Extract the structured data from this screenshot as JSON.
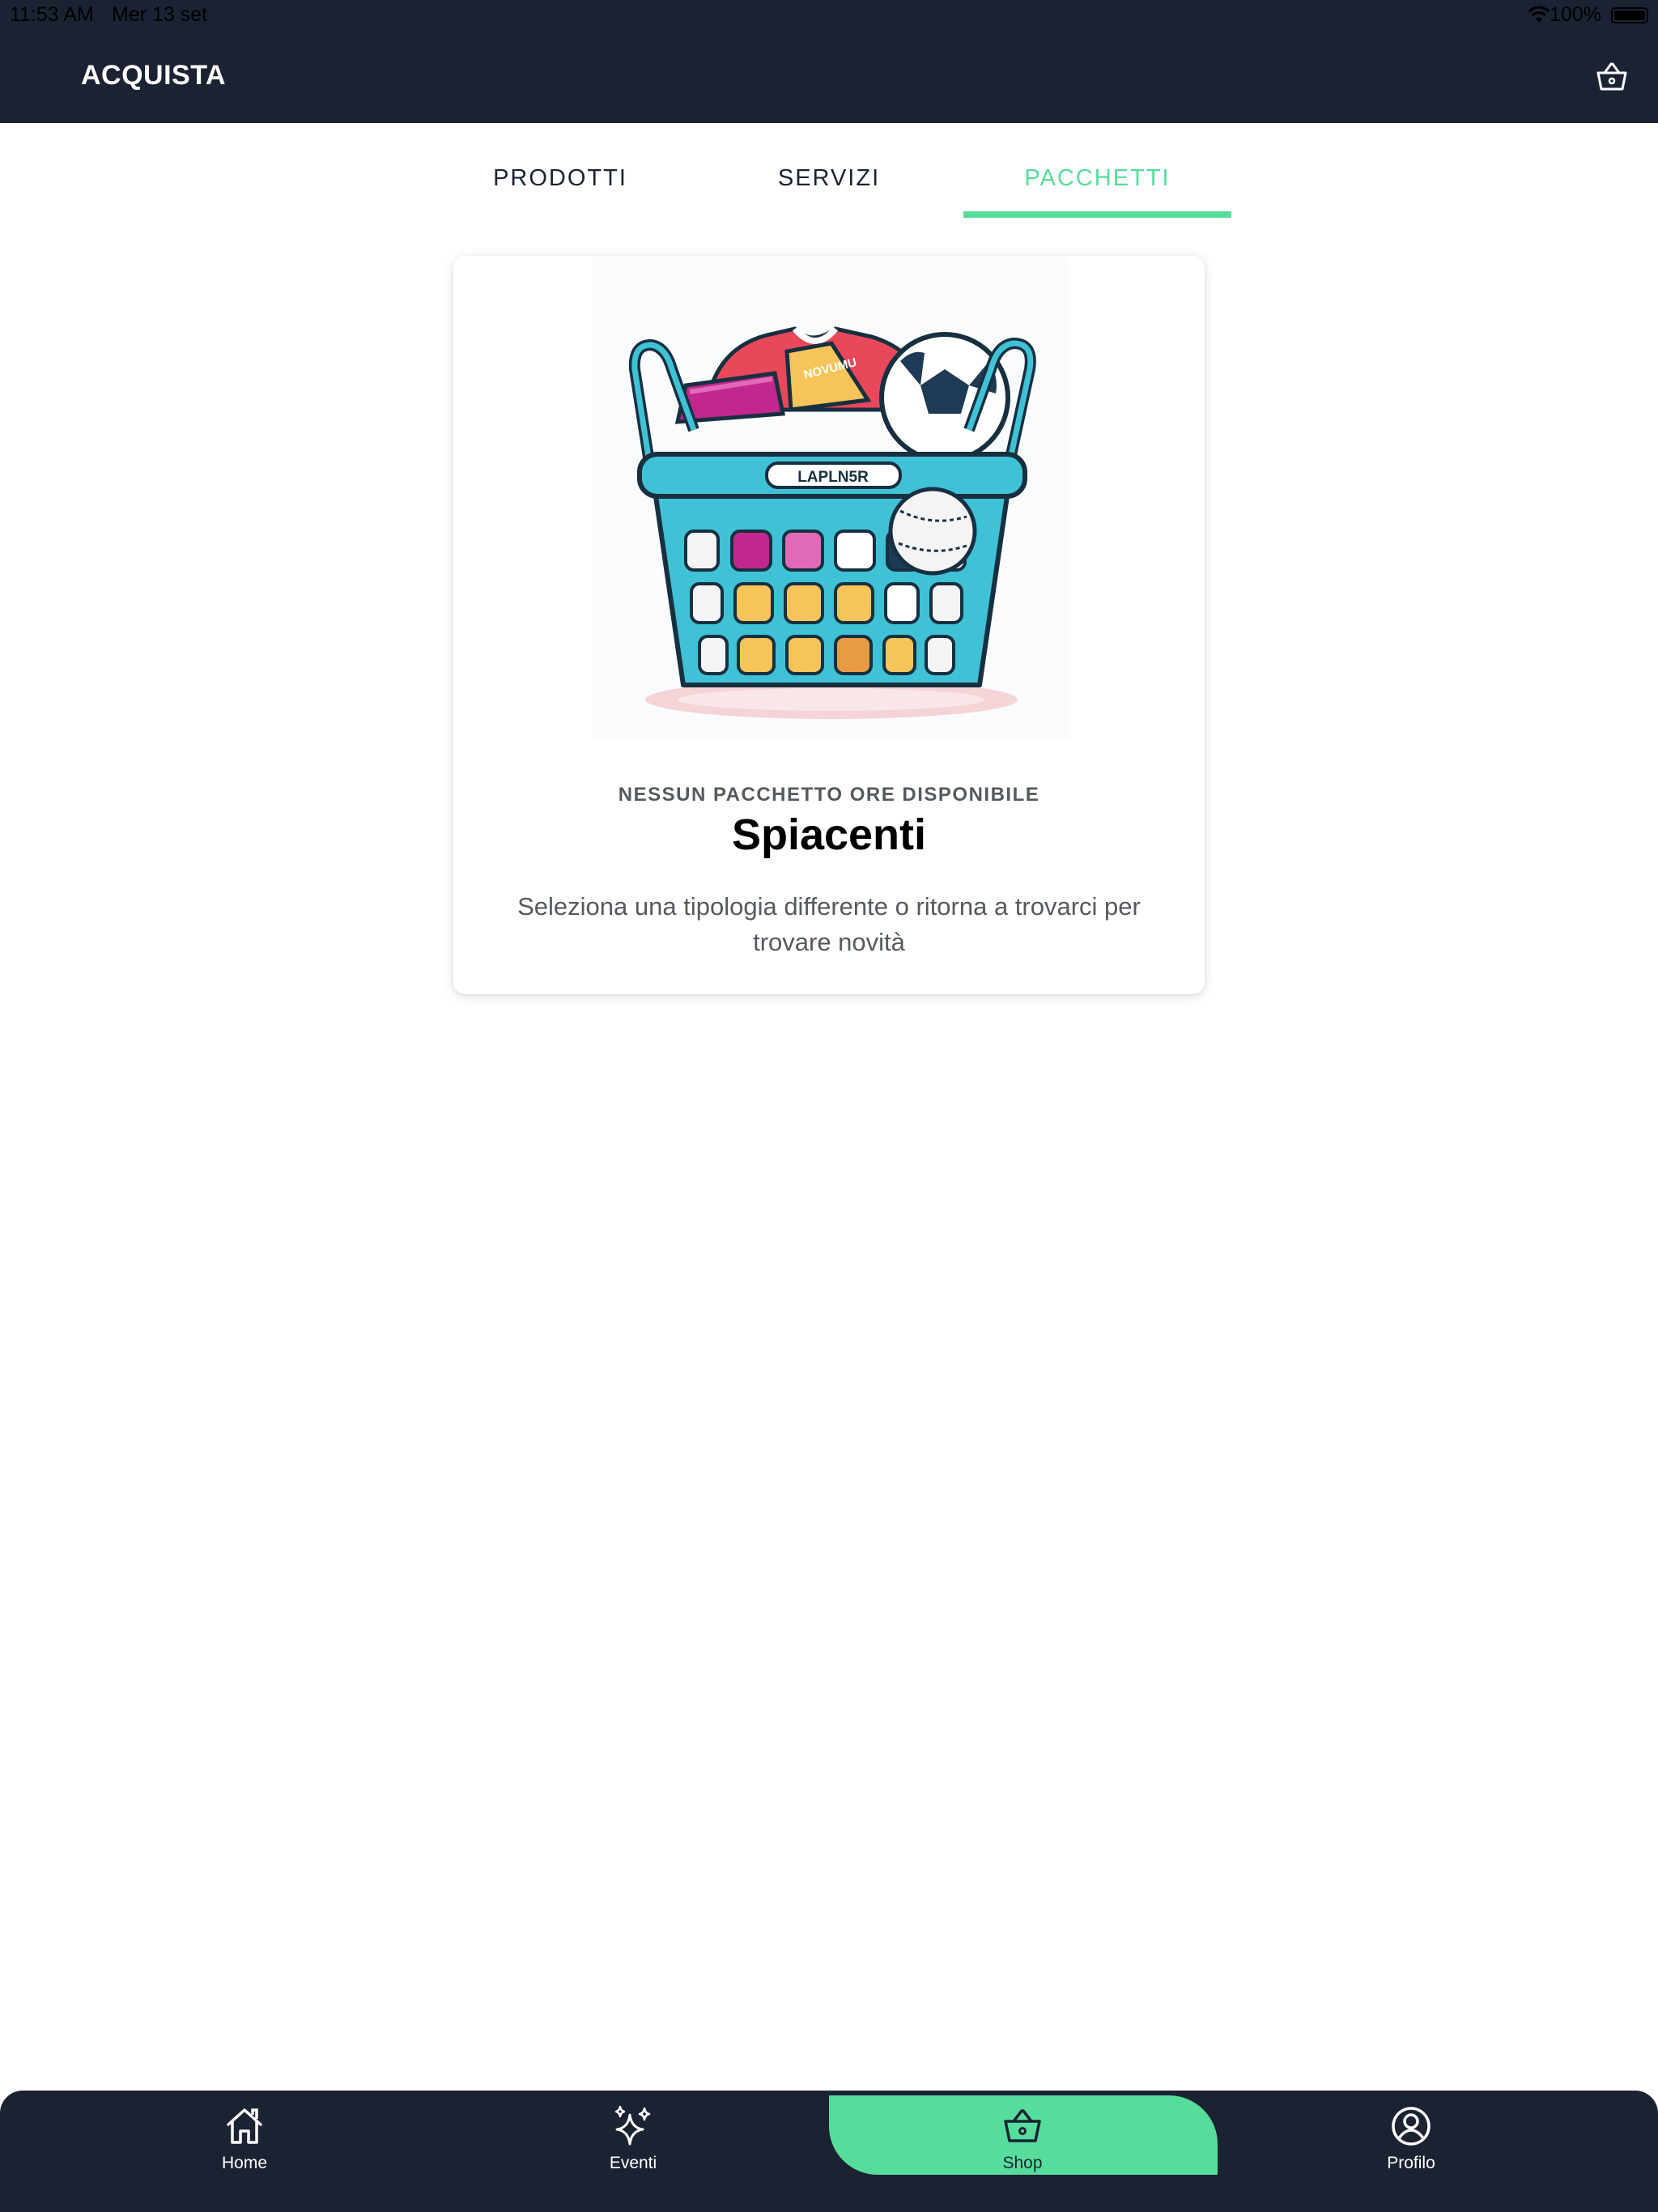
{
  "status_bar": {
    "time": "11:53 AM",
    "date": "Mer 13 set",
    "battery": "100%"
  },
  "header": {
    "title": "ACQUISTA",
    "cart_icon": "basket-icon"
  },
  "tabs": [
    {
      "label": "PRODOTTI",
      "active": false
    },
    {
      "label": "SERVIZI",
      "active": false
    },
    {
      "label": "PACCHETTI",
      "active": true
    }
  ],
  "empty_state": {
    "eyebrow": "NESSUN PACCHETTO ORE DISPONIBILE",
    "heading": "Spiacenti",
    "message": "Seleziona una tipologia differente o ritorna a trovarci per trovare novità",
    "basket_tag": "LAPLN5R",
    "price_tag": "NOVUMU"
  },
  "bottom_nav": [
    {
      "label": "Home",
      "icon": "home-icon",
      "active": false
    },
    {
      "label": "Eventi",
      "icon": "sparkles-icon",
      "active": false
    },
    {
      "label": "Shop",
      "icon": "basket-icon",
      "active": true
    },
    {
      "label": "Profilo",
      "icon": "user-circle-icon",
      "active": false
    }
  ],
  "colors": {
    "nav_background": "#1b2333",
    "accent": "#57dd9b",
    "text_muted": "#555a60"
  }
}
